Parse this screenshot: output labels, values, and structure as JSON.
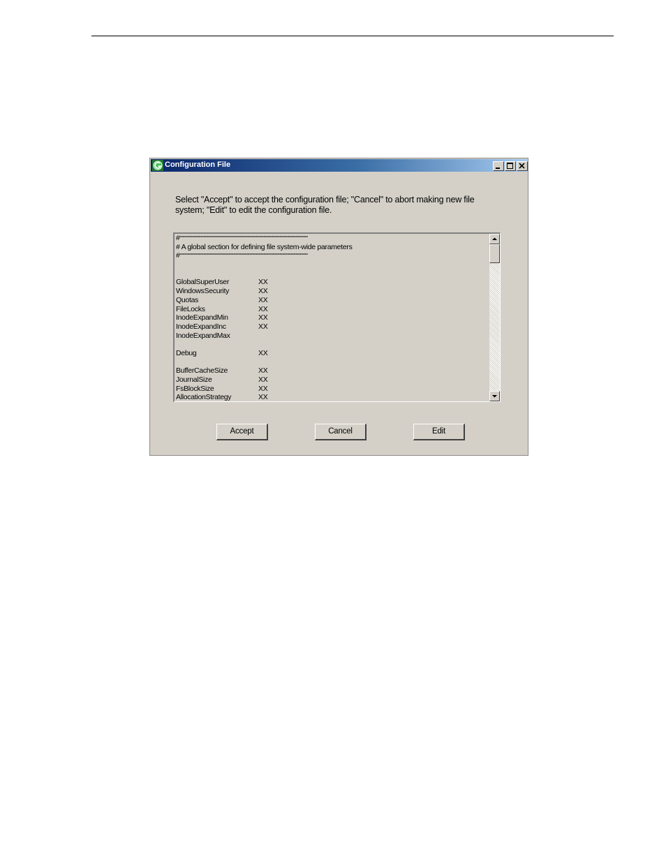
{
  "window": {
    "title": "Configuration File",
    "controls": {
      "minimize_icon": "minimize-icon",
      "maximize_icon": "maximize-icon",
      "close_icon": "close-icon"
    }
  },
  "message": {
    "line1": "Select \"Accept\" to accept the configuration file; \"Cancel\" to abort making new file",
    "line2": "system; \"Edit\" to edit the configuration file."
  },
  "config_text": {
    "hash_line_1_prefix": "#",
    "hash_line_1_stars": "****************************************************************************************************************************************",
    "comment_line": "# A global section for defining file system-wide parameters",
    "hash_line_2_prefix": "#",
    "hash_line_2_stars": "****************************************************************************************************************************************",
    "group1": [
      {
        "key": "GlobalSuperUser",
        "value": "XX"
      },
      {
        "key": "WindowsSecurity",
        "value": "XX"
      },
      {
        "key": "Quotas",
        "value": "XX"
      },
      {
        "key": "FileLocks",
        "value": "XX"
      },
      {
        "key": "InodeExpandMin",
        "value": "XX"
      },
      {
        "key": "InodeExpandInc",
        "value": "XX"
      },
      {
        "key": "InodeExpandMax",
        "value": ""
      }
    ],
    "group2": [
      {
        "key": "Debug",
        "value": "XX"
      }
    ],
    "group3": [
      {
        "key": "BufferCacheSize",
        "value": "XX"
      },
      {
        "key": "JournalSize",
        "value": "XX"
      },
      {
        "key": "FsBlockSize",
        "value": "XX"
      },
      {
        "key": "AllocationStrategy",
        "value": "XX"
      }
    ]
  },
  "buttons": {
    "accept": "Accept",
    "cancel": "Cancel",
    "edit": "Edit"
  },
  "colors": {
    "dialog_bg": "#d4d0c8",
    "titlebar_start": "#0a246a",
    "titlebar_end": "#a6caf0"
  }
}
